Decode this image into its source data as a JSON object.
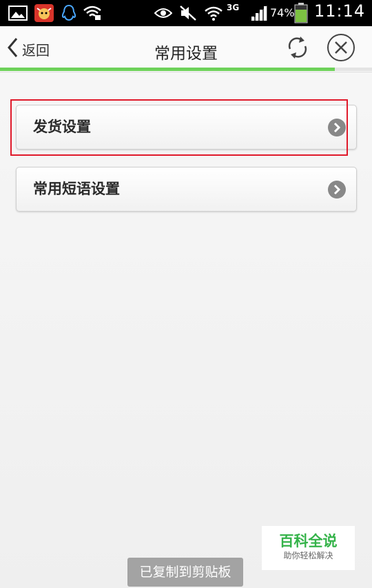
{
  "status_bar": {
    "network": "3G",
    "battery": "74%",
    "time": "11:14",
    "icons": [
      "gallery-icon",
      "app-cow-icon",
      "qq-penguin-icon",
      "wifi-lock-icon",
      "eye-icon",
      "mute-icon",
      "wifi-icon",
      "signal-icon",
      "battery-icon"
    ]
  },
  "header": {
    "back_label": "返回",
    "title": "常用设置",
    "icons": [
      "back-chevron-icon",
      "refresh-icon",
      "close-icon"
    ],
    "load_progress": 0.9
  },
  "settings": {
    "items": [
      {
        "label": "发货设置"
      },
      {
        "label": "常用短语设置"
      }
    ]
  },
  "toast": {
    "text": "已复制到剪贴板"
  },
  "watermark": {
    "title": "百科全说",
    "subtitle": "助你轻松解决"
  },
  "colors": {
    "progress_green": "#6ed25a",
    "highlight_red": "#e0192a",
    "battery_green": "#7cc142",
    "watermark_green": "#35b34a"
  }
}
